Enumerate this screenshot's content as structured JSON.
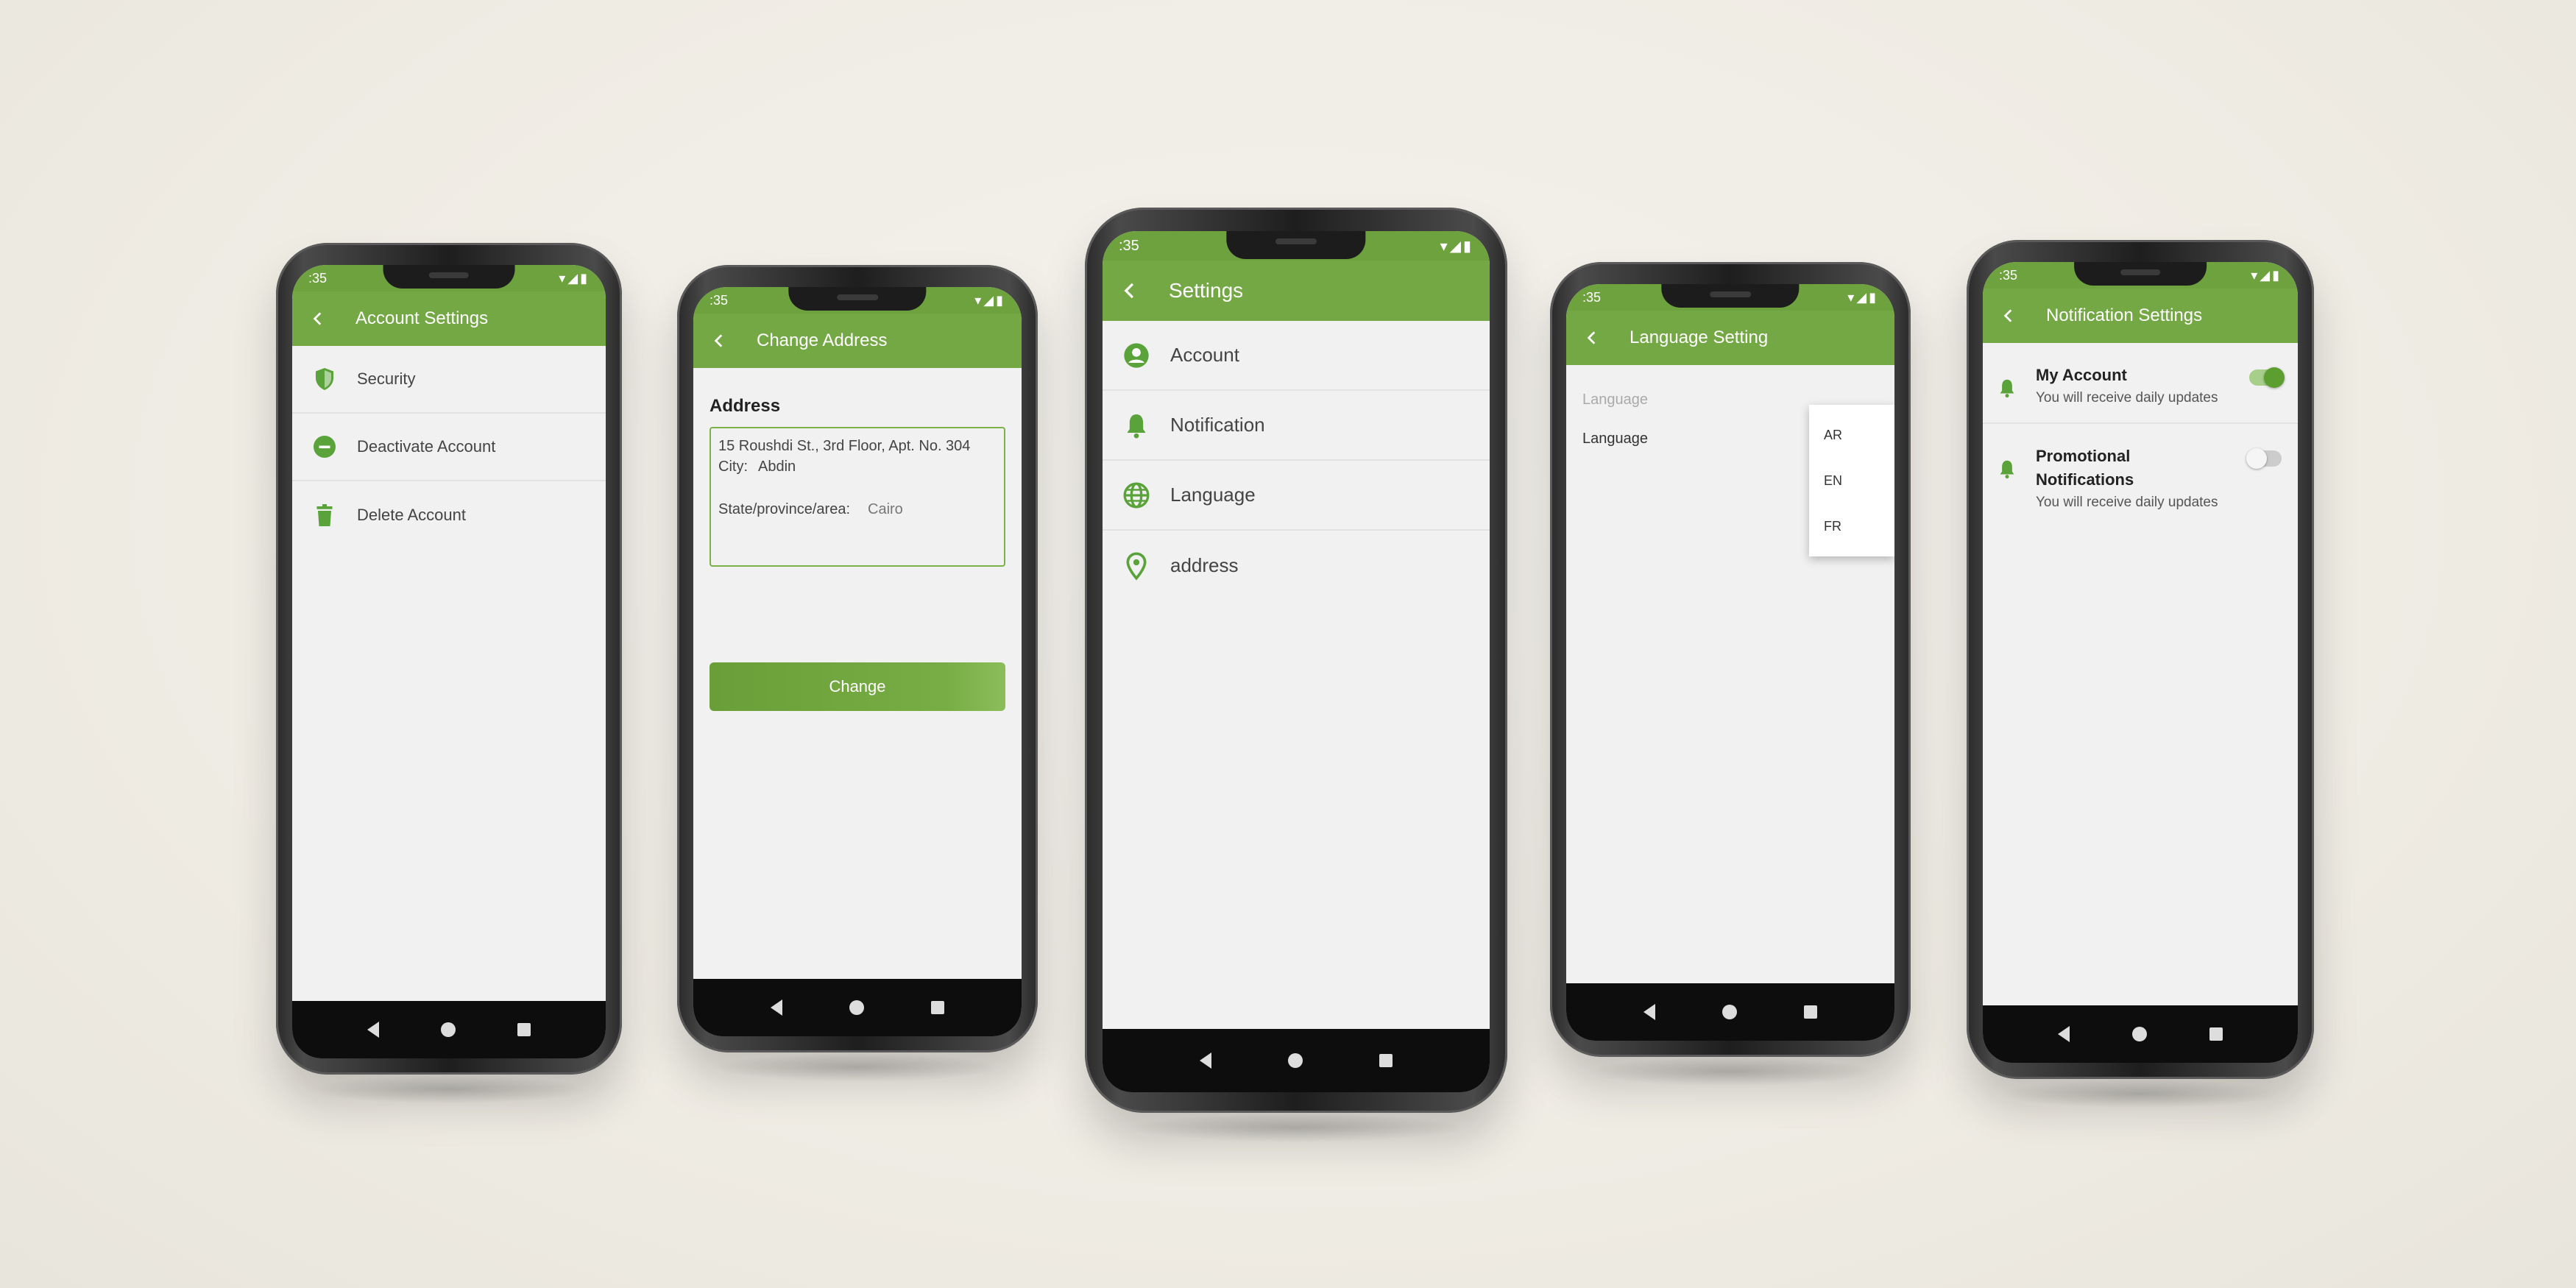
{
  "status_bar": {
    "time": ":35",
    "icons": "▾◢▮"
  },
  "phones": {
    "account_settings": {
      "title": "Account Settings",
      "items": [
        {
          "label": "Security",
          "icon": "shield-icon"
        },
        {
          "label": "Deactivate Account",
          "icon": "minus-circle-icon"
        },
        {
          "label": "Delete Account",
          "icon": "trash-icon"
        }
      ]
    },
    "change_address": {
      "title": "Change Address",
      "section_label": "Address",
      "street": "15 Roushdi St., 3rd Floor, Apt. No. 304",
      "city_label": "City:",
      "city_value": "Abdin",
      "state_label": "State/province/area:",
      "state_value": "Cairo",
      "button_label": "Change"
    },
    "settings": {
      "title": "Settings",
      "items": [
        {
          "label": "Account",
          "icon": "user-circle-icon"
        },
        {
          "label": "Notification",
          "icon": "bell-icon"
        },
        {
          "label": "Language",
          "icon": "globe-icon"
        },
        {
          "label": "address",
          "icon": "location-pin-icon"
        }
      ]
    },
    "language_setting": {
      "title": "Language Setting",
      "hint": "Language",
      "row_label": "Language",
      "options": [
        "AR",
        "EN",
        "FR"
      ]
    },
    "notification_settings": {
      "title": "Notification Settings",
      "items": [
        {
          "title": "My Account",
          "description": "You will receive daily updates",
          "enabled": true
        },
        {
          "title": "Promotional Notifications",
          "description": "You will receive daily updates",
          "enabled": false
        }
      ]
    }
  },
  "colors": {
    "primary": "#74a844",
    "status": "#6ea23e",
    "accent": "#5c9e2f"
  }
}
